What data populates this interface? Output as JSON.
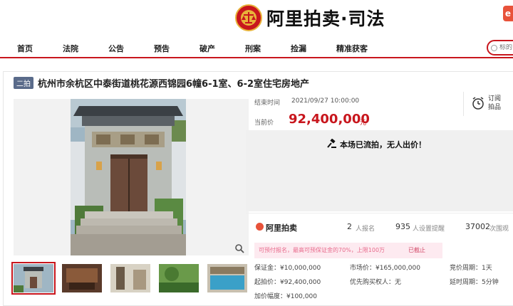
{
  "header": {
    "logo_text": "阿里拍卖·司法",
    "corner_badge": "e"
  },
  "nav": {
    "items": [
      "首页",
      "法院",
      "公告",
      "预告",
      "破产",
      "刑案",
      "捡漏",
      "精准获客"
    ],
    "search_placeholder": "标的"
  },
  "item": {
    "round_badge": "二拍",
    "title": "杭州市余杭区中泰街道桃花源西锦园6幢6-1室、6-2室住宅房地产",
    "end_time_label": "结束时间",
    "end_time": "2021/09/27 10:00:00",
    "current_price_label": "当前价",
    "current_price": "92,400,000",
    "price_unit": "元",
    "remind_label": "订阅拍品",
    "status": "本场已流拍，无人出价！",
    "brand": "阿里拍卖",
    "stats": [
      {
        "num": "2",
        "label": "人报名"
      },
      {
        "num": "935",
        "label": "人设置提醒"
      },
      {
        "num": "37002",
        "label": "次围观"
      }
    ],
    "notice": "可预付报名，最高可预保证金的70%，上限100万",
    "notice_tag": "已截止",
    "details": [
      {
        "label": "保证金：¥10,000,000"
      },
      {
        "label": "市场价：¥165,000,000"
      },
      {
        "label": "竞价周期：1天"
      },
      {
        "label": "起拍价：¥92,400,000"
      },
      {
        "label": "优先购买权人：无"
      },
      {
        "label": "延时周期：5分钟"
      },
      {
        "label": "加价幅度：¥100,000"
      }
    ]
  },
  "colors": {
    "accent": "#c8161d",
    "price": "#c8161d",
    "badge": "#5a6b8a"
  }
}
